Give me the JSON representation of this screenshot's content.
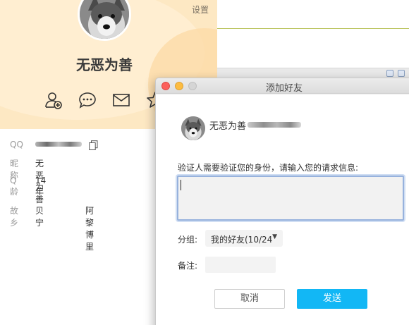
{
  "profile": {
    "settings_label": "设置",
    "name": "无恶为善",
    "actions": [
      {
        "icon": "add-friend-icon"
      },
      {
        "icon": "chat-icon"
      },
      {
        "icon": "mail-icon"
      },
      {
        "icon": "star-icon"
      }
    ],
    "info": {
      "qq_label": "QQ",
      "nickname_label": "昵称",
      "nickname_value": "无恶为善",
      "qage_label": "Q龄",
      "qage_value": "14年",
      "hometown_label": "故乡",
      "hometown_province": "贝宁",
      "hometown_city": "阿黎博里"
    }
  },
  "dialog": {
    "title": "添加好友",
    "target_name": "无恶为善",
    "verify_label": "验证人需要验证您的身份，请输入您的请求信息:",
    "verify_value": "",
    "group_label": "分组:",
    "group_value": "我的好友(10/24",
    "remark_label": "备注:",
    "remark_value": "",
    "cancel_label": "取消",
    "send_label": "发送"
  },
  "colors": {
    "accent": "#12b7f5",
    "header_bg": "#fde8c3",
    "close": "#fc605c",
    "minimize": "#fdbc40"
  }
}
